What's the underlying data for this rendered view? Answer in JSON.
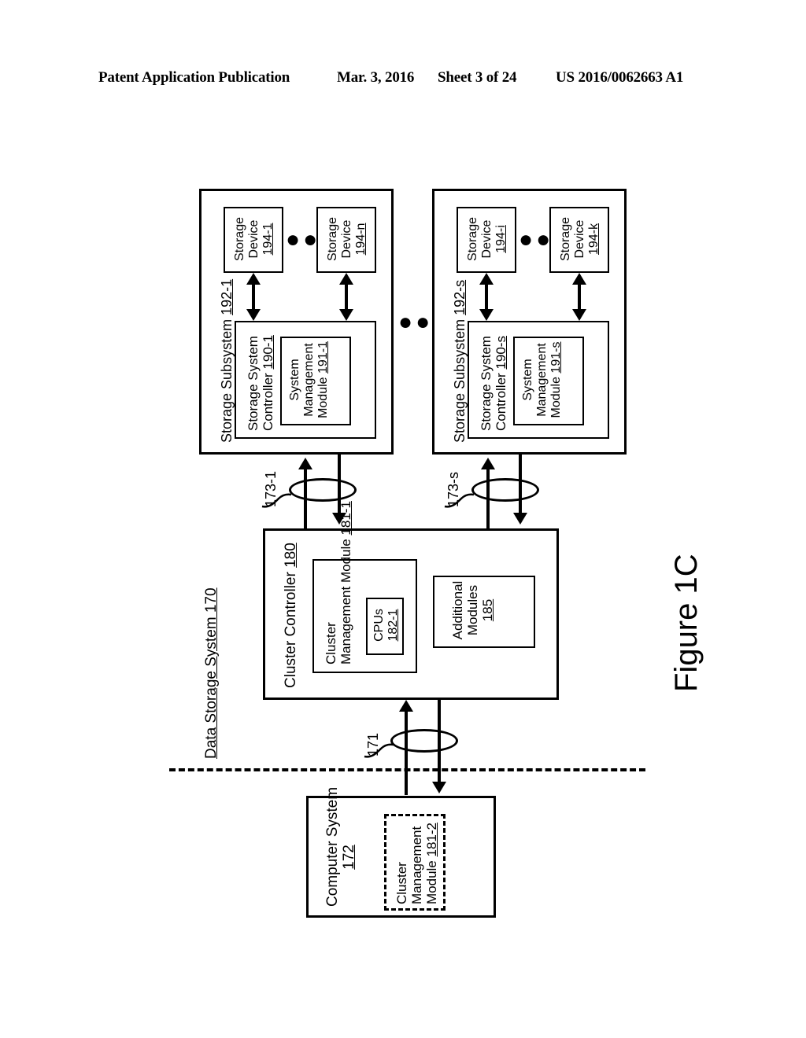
{
  "header": {
    "publication": "Patent Application Publication",
    "date": "Mar. 3, 2016",
    "sheet": "Sheet 3 of 24",
    "number": "US 2016/0062663 A1"
  },
  "figure": {
    "caption": "Figure 1C"
  },
  "diagram": {
    "system_label": "Data Storage System 170",
    "system_ref": "170",
    "storage_subsystems": [
      {
        "label": "Storage Subsystem 192-1",
        "ref": "192-1",
        "controller": {
          "label": "Storage System Controller 190-1",
          "ref": "190-1",
          "module": {
            "line1": "System",
            "line2": "Management",
            "line3": "Module 191-1",
            "ref": "191-1"
          }
        },
        "devices": [
          {
            "line1": "Storage",
            "line2": "Device",
            "line3": "194-1",
            "ref": "194-1"
          },
          {
            "line1": "Storage",
            "line2": "Device",
            "line3": "194-n",
            "ref": "194-n"
          }
        ],
        "device_ellipsis": "●●●",
        "bus_label": "173-1"
      },
      {
        "label": "Storage Subsystem 192-s",
        "ref": "192-s",
        "controller": {
          "label": "Storage System Controller 190-s",
          "ref": "190-s",
          "module": {
            "line1": "System",
            "line2": "Management",
            "line3": "Module 191-s",
            "ref": "191-s"
          }
        },
        "devices": [
          {
            "line1": "Storage",
            "line2": "Device",
            "line3": "194-i",
            "ref": "194-i"
          },
          {
            "line1": "Storage",
            "line2": "Device",
            "line3": "194-k",
            "ref": "194-k"
          }
        ],
        "device_ellipsis": "●●●",
        "bus_label": "173-s"
      }
    ],
    "subsystem_ellipsis": "●●●",
    "cluster_controller": {
      "label": "Cluster Controller 180",
      "ref": "180",
      "cluster_management_module": {
        "line1": "Cluster",
        "line2": "Management",
        "line3": "Module 181-1",
        "ref": "181-1"
      },
      "cpus": {
        "line1": "CPUs",
        "line2": "182-1",
        "ref": "182-1"
      },
      "additional_modules": {
        "line1": "Additional",
        "line2": "Modules",
        "line3": "185",
        "ref": "185"
      }
    },
    "host_bus_label": "171",
    "computer_system": {
      "line1": "Computer System",
      "line2": "172",
      "ref": "172",
      "cluster_management_module": {
        "line1": "Cluster",
        "line2": "Management",
        "line3": "Module 181-2",
        "ref": "181-2"
      }
    }
  }
}
